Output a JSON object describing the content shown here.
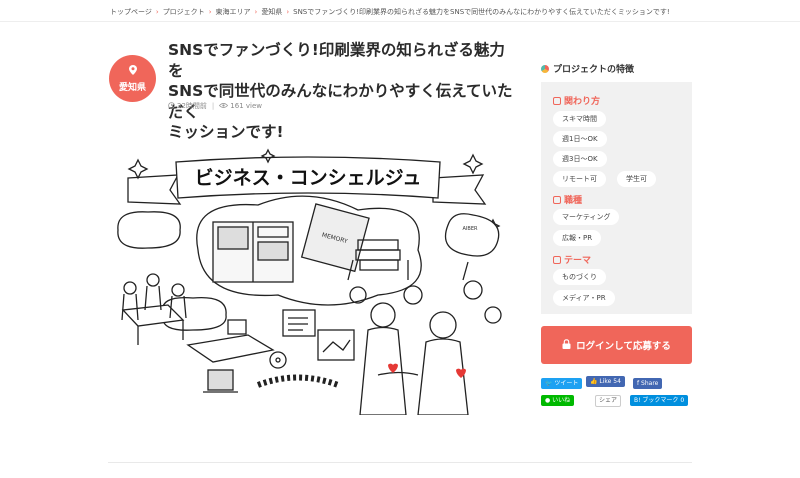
{
  "breadcrumb": {
    "items": [
      "トップページ",
      "プロジェクト",
      "東海エリア",
      "愛知県",
      "SNSでファンづくり!印刷業界の知られざる魅力をSNSで同世代のみんなにわかりやすく伝えていただくミッションです!"
    ],
    "separator": "›"
  },
  "project": {
    "prefecture": "愛知県",
    "title_lines": [
      "SNSでファンづくり!印刷業界の知られざる魅力を",
      "SNSで同世代のみんなにわかりやすく伝えていただく",
      "ミッションです!"
    ],
    "posted": "22時間前",
    "views": "161 view"
  },
  "illustration": {
    "banner_text": "ビジネス・コンシェルジュ",
    "bubble_note_1": "「お客様から依頼。製品できました。ご確認ください」",
    "bubble_note_2": "「お客様の新しい製品ができました! よろしくお願いします」",
    "book_label": "MEMORY",
    "sign_label": "AIBER"
  },
  "sidebar": {
    "heading": "プロジェクトの特徴",
    "sections": [
      {
        "title": "関わり方",
        "tags": [
          "スキマ時間",
          "週1日〜OK",
          "週3日〜OK",
          "リモート可",
          "学生可"
        ]
      },
      {
        "title": "職種",
        "tags": [
          "マーケティング",
          "広報・PR"
        ]
      },
      {
        "title": "テーマ",
        "tags": [
          "ものづくり",
          "メディア・PR"
        ]
      }
    ]
  },
  "cta": {
    "login_label": "ログインして応募する"
  },
  "share": {
    "tweet": "ツイート",
    "fb_like": "Like",
    "fb_like_count": "54",
    "fb_share": "Share",
    "line": "いいね",
    "line_share": "シェア",
    "hatena": "B! ブックマーク",
    "hatena_count": "0"
  },
  "colors": {
    "accent": "#f0665a",
    "twitter": "#1da1f2",
    "facebook": "#4267b2",
    "line": "#00b900",
    "hatena": "#008fde"
  },
  "icons": [
    "location-pin-icon",
    "clock-icon",
    "eye-icon",
    "calendar-icon",
    "lock-icon"
  ]
}
